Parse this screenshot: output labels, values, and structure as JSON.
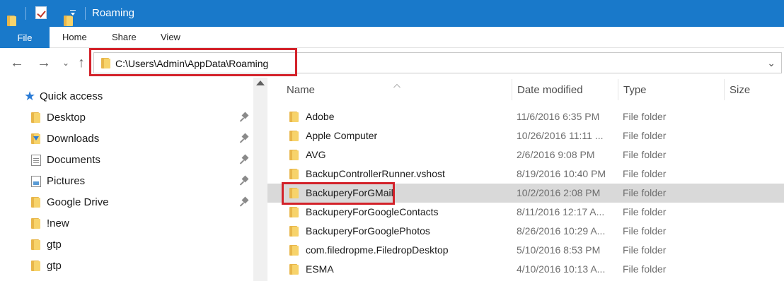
{
  "window": {
    "title": "Roaming"
  },
  "ribbon": {
    "file_tab": "File",
    "tabs": [
      "Home",
      "Share",
      "View"
    ]
  },
  "address": {
    "path": "C:\\Users\\Admin\\AppData\\Roaming"
  },
  "navigation": {
    "quick_access_label": "Quick access",
    "items": [
      {
        "label": "Desktop",
        "icon": "folder-icon",
        "pinned": true
      },
      {
        "label": "Downloads",
        "icon": "download-folder-icon",
        "pinned": true
      },
      {
        "label": "Documents",
        "icon": "documents-icon",
        "pinned": true
      },
      {
        "label": "Pictures",
        "icon": "pictures-icon",
        "pinned": true
      },
      {
        "label": "Google Drive",
        "icon": "folder-icon",
        "pinned": true
      },
      {
        "label": "!new",
        "icon": "folder-icon",
        "pinned": false
      },
      {
        "label": "gtp",
        "icon": "folder-icon",
        "pinned": false
      },
      {
        "label": "gtp",
        "icon": "folder-icon",
        "pinned": false
      }
    ]
  },
  "file_list": {
    "columns": [
      "Name",
      "Date modified",
      "Type",
      "Size"
    ],
    "rows": [
      {
        "name": "Adobe",
        "date": "11/6/2016 6:35 PM",
        "type": "File folder"
      },
      {
        "name": "Apple Computer",
        "date": "10/26/2016 11:11 ...",
        "type": "File folder"
      },
      {
        "name": "AVG",
        "date": "2/6/2016 9:08 PM",
        "type": "File folder"
      },
      {
        "name": "BackupControllerRunner.vshost",
        "date": "8/19/2016 10:40 PM",
        "type": "File folder"
      },
      {
        "name": "BackuperyForGMail",
        "date": "10/2/2016 2:08 PM",
        "type": "File folder",
        "selected": true
      },
      {
        "name": "BackuperyForGoogleContacts",
        "date": "8/11/2016 12:17 A...",
        "type": "File folder"
      },
      {
        "name": "BackuperyForGooglePhotos",
        "date": "8/26/2016 10:29 A...",
        "type": "File folder"
      },
      {
        "name": "com.filedropme.FiledropDesktop",
        "date": "5/10/2016 8:53 PM",
        "type": "File folder"
      },
      {
        "name": "ESMA",
        "date": "4/10/2016 10:13 A...",
        "type": "File folder"
      }
    ]
  },
  "colors": {
    "accent": "#1979ca",
    "highlight_box": "#d3222a",
    "selected_row": "#d9d9d9",
    "folder": "#f7d36b"
  }
}
